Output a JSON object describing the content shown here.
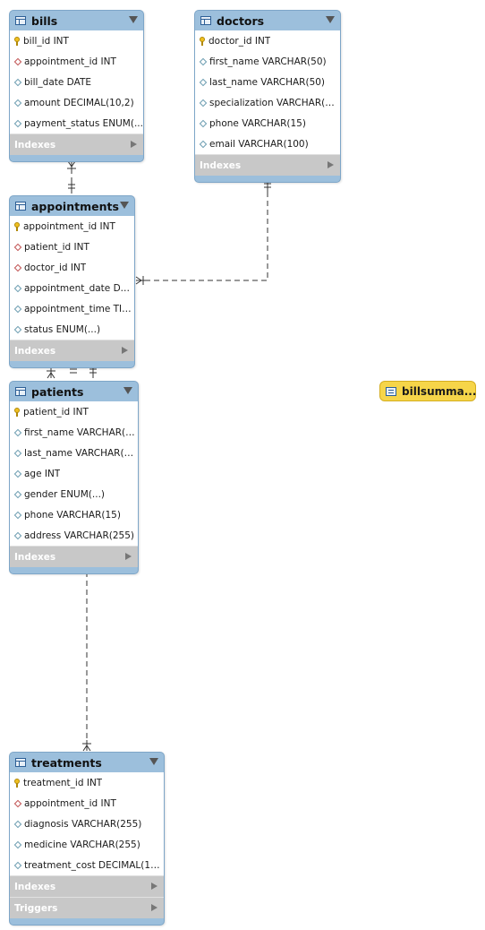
{
  "tables": {
    "bills": {
      "name": "bills",
      "columns": [
        {
          "text": "bill_id INT",
          "key": "pk"
        },
        {
          "text": "appointment_id INT",
          "key": "fk"
        },
        {
          "text": "bill_date DATE",
          "key": "attr"
        },
        {
          "text": "amount DECIMAL(10,2)",
          "key": "attr"
        },
        {
          "text": "payment_status ENUM(...",
          "key": "attr"
        }
      ],
      "sections": [
        "Indexes"
      ]
    },
    "doctors": {
      "name": "doctors",
      "columns": [
        {
          "text": "doctor_id INT",
          "key": "pk"
        },
        {
          "text": "first_name VARCHAR(50)",
          "key": "attr"
        },
        {
          "text": "last_name VARCHAR(50)",
          "key": "attr"
        },
        {
          "text": "specialization VARCHAR(10...",
          "key": "attr"
        },
        {
          "text": "phone VARCHAR(15)",
          "key": "attr"
        },
        {
          "text": "email VARCHAR(100)",
          "key": "attr"
        }
      ],
      "sections": [
        "Indexes"
      ]
    },
    "appointments": {
      "name": "appointments",
      "columns": [
        {
          "text": "appointment_id INT",
          "key": "pk"
        },
        {
          "text": "patient_id INT",
          "key": "fk"
        },
        {
          "text": "doctor_id INT",
          "key": "fk"
        },
        {
          "text": "appointment_date DA...",
          "key": "attr"
        },
        {
          "text": "appointment_time TIME",
          "key": "attr"
        },
        {
          "text": "status ENUM(...)",
          "key": "attr"
        }
      ],
      "sections": [
        "Indexes"
      ]
    },
    "patients": {
      "name": "patients",
      "columns": [
        {
          "text": "patient_id INT",
          "key": "pk"
        },
        {
          "text": "first_name VARCHAR(5...",
          "key": "attr"
        },
        {
          "text": "last_name VARCHAR(50)",
          "key": "attr"
        },
        {
          "text": "age INT",
          "key": "attr"
        },
        {
          "text": "gender ENUM(...)",
          "key": "attr"
        },
        {
          "text": "phone VARCHAR(15)",
          "key": "attr"
        },
        {
          "text": "address VARCHAR(255)",
          "key": "attr"
        }
      ],
      "sections": [
        "Indexes"
      ]
    },
    "treatments": {
      "name": "treatments",
      "columns": [
        {
          "text": "treatment_id INT",
          "key": "pk"
        },
        {
          "text": "appointment_id INT",
          "key": "fk"
        },
        {
          "text": "diagnosis VARCHAR(255)",
          "key": "attr"
        },
        {
          "text": "medicine VARCHAR(255)",
          "key": "attr"
        },
        {
          "text": "treatment_cost DECIMAL(10,...",
          "key": "attr"
        }
      ],
      "sections": [
        "Indexes",
        "Triggers"
      ]
    }
  },
  "view": {
    "name": "billsumma...",
    "icon": "view-icon"
  },
  "colors": {
    "table_header": "#9cbfdc",
    "section_bg": "#c8c8c8",
    "view_bg": "#f6d549",
    "primary_key": "#f0c020",
    "foreign_key": "#c05050",
    "attribute": "#6a9cb0"
  }
}
